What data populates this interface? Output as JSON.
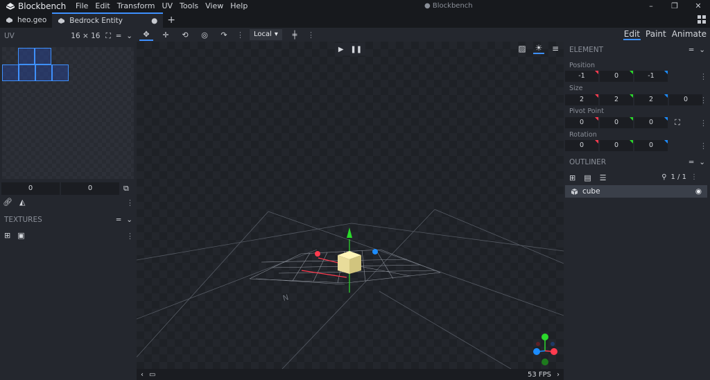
{
  "app": {
    "name": "Blockbench",
    "window_title": "● Blockbench"
  },
  "menu": [
    "File",
    "Edit",
    "Transform",
    "UV",
    "Tools",
    "View",
    "Help"
  ],
  "tabs": [
    {
      "label": "heo.geo"
    },
    {
      "label": "Bedrock Entity",
      "modified": "●"
    }
  ],
  "left_panel": {
    "uv": {
      "title": "UV",
      "resolution": "16 × 16",
      "offset_x": "0",
      "offset_y": "0"
    },
    "textures": {
      "title": "TEXTURES"
    }
  },
  "viewport": {
    "transform_space": "Local",
    "fps": "53 FPS"
  },
  "right_panel": {
    "modes": [
      "Edit",
      "Paint",
      "Animate"
    ],
    "active_mode": "Edit",
    "element": {
      "title": "ELEMENT",
      "position": {
        "label": "Position",
        "values": [
          "-1",
          "0",
          "-1"
        ]
      },
      "size": {
        "label": "Size",
        "values": [
          "2",
          "2",
          "2",
          "0"
        ]
      },
      "pivot": {
        "label": "Pivot Point",
        "values": [
          "0",
          "0",
          "0"
        ]
      },
      "rotation": {
        "label": "Rotation",
        "values": [
          "0",
          "0",
          "0"
        ]
      }
    },
    "outliner": {
      "title": "OUTLINER",
      "count": "1 / 1",
      "items": [
        {
          "name": "cube"
        }
      ]
    }
  },
  "colors": {
    "accent": "#3e90ff",
    "axis_x": "#ff3b4f",
    "axis_y": "#2bd92b",
    "axis_z": "#1c8cff"
  }
}
